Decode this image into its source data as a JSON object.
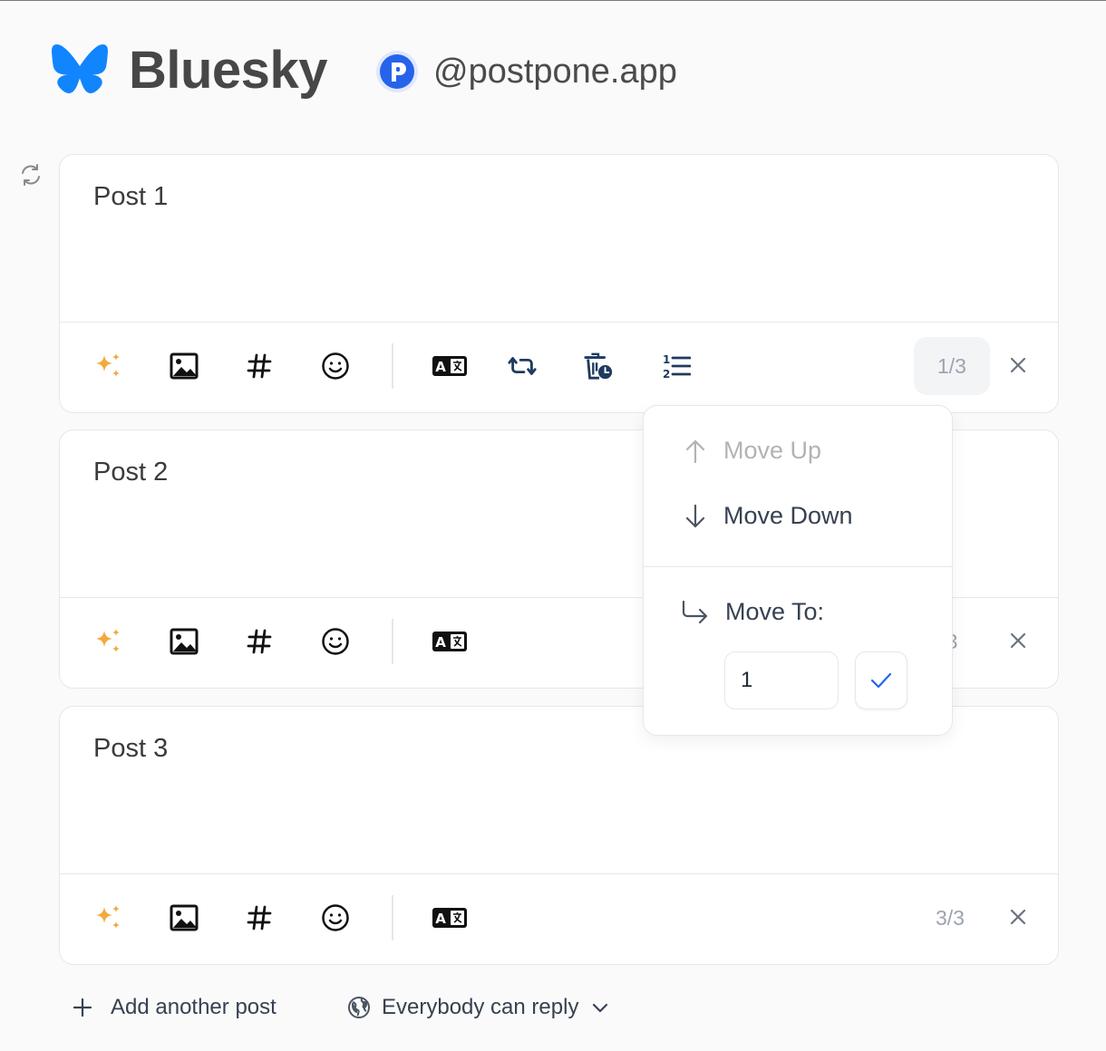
{
  "brand": {
    "name": "Bluesky",
    "color": "#1185fe"
  },
  "account": {
    "handle": "@postpone.app",
    "avatar_color": "#2563eb"
  },
  "posts": [
    {
      "text": "Post 1",
      "counter": "1/3"
    },
    {
      "text": "Post 2",
      "counter": "3"
    },
    {
      "text": "Post 3",
      "counter": "3/3"
    }
  ],
  "toolbar_icons": [
    "ai-sparkle-icon",
    "image-icon",
    "hashtag-icon",
    "emoji-icon",
    "translate-icon",
    "repost-icon",
    "delete-schedule-icon",
    "reorder-list-icon"
  ],
  "reorder_menu": {
    "move_up": "Move Up",
    "move_down": "Move Down",
    "move_to": "Move To:",
    "move_to_value": "1"
  },
  "footer": {
    "add_post": "Add another post",
    "reply_setting": "Everybody can reply"
  },
  "colors": {
    "sparkle": "#f3a93b",
    "navy": "#1e3a5f",
    "confirm": "#2563eb"
  }
}
